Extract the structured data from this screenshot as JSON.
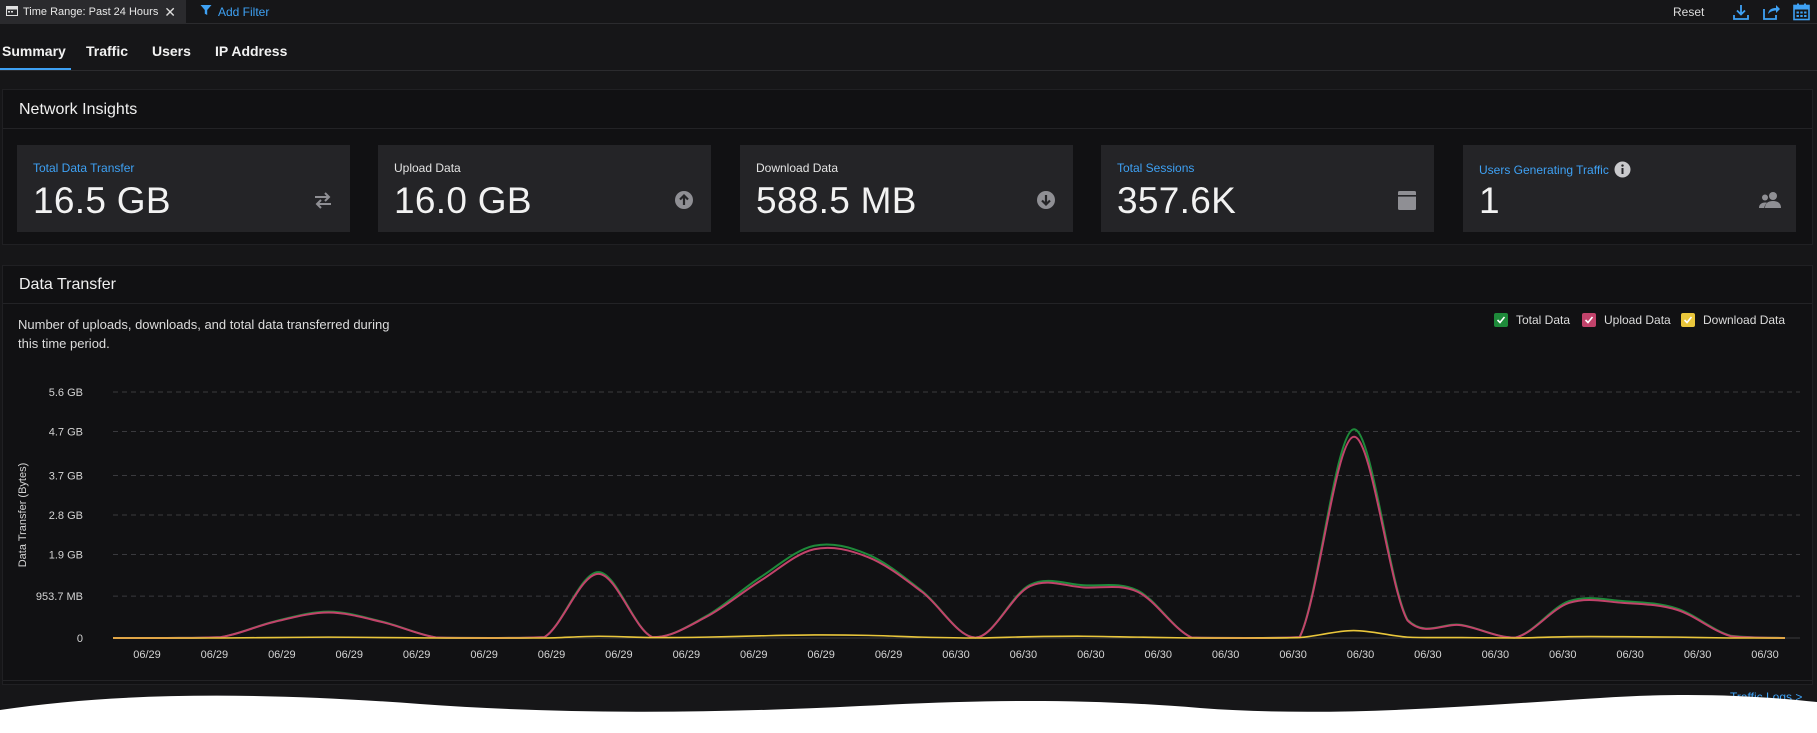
{
  "filter_bar": {
    "time_range_label": "Time Range: Past 24 Hours",
    "close_glyph": "✕",
    "add_filter_label": "Add Filter",
    "reset_label": "Reset",
    "icons": [
      "download-icon",
      "share-icon",
      "calendar-icon"
    ]
  },
  "tabs": [
    "Summary",
    "Traffic",
    "Users",
    "IP Address"
  ],
  "network_insights": {
    "title": "Network Insights",
    "cards": [
      {
        "label": "Total Data Transfer",
        "value": "16.5 GB",
        "icon": "transfer-arrows-icon",
        "accent": true
      },
      {
        "label": "Upload Data",
        "value": "16.0 GB",
        "icon": "upload-icon",
        "accent": false
      },
      {
        "label": "Download Data",
        "value": "588.5 MB",
        "icon": "download-circle-icon",
        "accent": false
      },
      {
        "label": "Total Sessions",
        "value": "357.6K",
        "icon": "sessions-icon",
        "accent": true
      },
      {
        "label": "Users Generating Traffic",
        "value": "1",
        "icon": "users-icon",
        "accent": true
      }
    ]
  },
  "data_transfer": {
    "title": "Data Transfer",
    "description": "Number of uploads, downloads, and total data transferred during this time period.",
    "legend": [
      {
        "label": "Total Data",
        "color": "#1e8a3a"
      },
      {
        "label": "Upload Data",
        "color": "#c2436b"
      },
      {
        "label": "Download Data",
        "color": "#e9c63b"
      }
    ],
    "traffic_logs_link": "Traffic Logs >"
  },
  "chart_data": {
    "type": "line",
    "ylabel": "Data Transfer (Bytes)",
    "y_tick_labels": [
      "0",
      "953.7 MB",
      "1.9 GB",
      "2.8 GB",
      "3.7 GB",
      "4.7 GB",
      "5.6 GB"
    ],
    "y_tick_values_gb": [
      0,
      0.9537,
      1.9,
      2.8,
      3.7,
      4.7,
      5.6
    ],
    "ylim": [
      0,
      5.6
    ],
    "categories": [
      "06/29",
      "06/29",
      "06/29",
      "06/29",
      "06/29",
      "06/29",
      "06/29",
      "06/29",
      "06/29",
      "06/29",
      "06/29",
      "06/29",
      "06/30",
      "06/30",
      "06/30",
      "06/30",
      "06/30",
      "06/30",
      "06/30",
      "06/30",
      "06/30",
      "06/30",
      "06/30",
      "06/30",
      "06/30"
    ],
    "grid": "horizontal dashed",
    "series": [
      {
        "name": "Total Data",
        "color": "#1e8a3a",
        "values": [
          0,
          0,
          0.02,
          0.38,
          0.6,
          0.37,
          0.01,
          0,
          0.02,
          1.5,
          0.02,
          0.5,
          1.38,
          2.1,
          1.9,
          1.07,
          0.01,
          1.21,
          1.2,
          1.08,
          0.01,
          0,
          0.02,
          4.75,
          0.42,
          0.3,
          0.01,
          0.84,
          0.84,
          0.67,
          0.05,
          0
        ]
      },
      {
        "name": "Upload Data",
        "color": "#c2436b",
        "values": [
          0,
          0,
          0.02,
          0.37,
          0.58,
          0.36,
          0.01,
          0,
          0.02,
          1.46,
          0.02,
          0.48,
          1.3,
          2.02,
          1.84,
          1.05,
          0.01,
          1.18,
          1.15,
          1.05,
          0.01,
          0,
          0.02,
          4.58,
          0.4,
          0.29,
          0.01,
          0.8,
          0.8,
          0.64,
          0.04,
          0
        ]
      },
      {
        "name": "Download Data",
        "color": "#e9c63b",
        "values": [
          0,
          0,
          0,
          0.01,
          0.02,
          0.01,
          0,
          0,
          0,
          0.04,
          0.01,
          0.02,
          0.05,
          0.07,
          0.06,
          0.02,
          0,
          0.03,
          0.04,
          0.02,
          0,
          0,
          0.01,
          0.17,
          0.02,
          0.01,
          0,
          0.03,
          0.03,
          0.02,
          0,
          0
        ]
      }
    ]
  }
}
